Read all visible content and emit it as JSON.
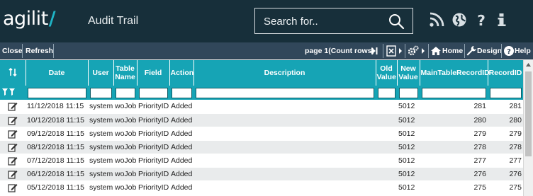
{
  "header": {
    "logo_text": "agilit",
    "title": "Audit Trail",
    "search_placeholder": "Search for..",
    "icons": [
      "rss-icon",
      "globe-icon",
      "help-icon",
      "info-icon"
    ]
  },
  "toolbar": {
    "close_label": "Close",
    "refresh_label": "Refresh",
    "page_text": "page 1(Count rows)",
    "home_label": "Home",
    "design_label": "Design",
    "help_label": "Help"
  },
  "grid": {
    "sort_icon": "sort-icon",
    "columns": [
      "Date",
      "User",
      "Table Name",
      "Field",
      "Action",
      "Description",
      "Old Value",
      "New Value",
      "MainTableRecordID",
      "RecordID"
    ],
    "rows": [
      {
        "date": "11/12/2018 11:15",
        "user": "system",
        "table": "woJob",
        "field": "PriorityID",
        "action": "Added",
        "description": "",
        "old": "",
        "new": "5012",
        "main_id": "281",
        "record_id": "281"
      },
      {
        "date": "10/12/2018 11:15",
        "user": "system",
        "table": "woJob",
        "field": "PriorityID",
        "action": "Added",
        "description": "",
        "old": "",
        "new": "5012",
        "main_id": "280",
        "record_id": "280"
      },
      {
        "date": "09/12/2018 11:15",
        "user": "system",
        "table": "woJob",
        "field": "PriorityID",
        "action": "Added",
        "description": "",
        "old": "",
        "new": "5012",
        "main_id": "279",
        "record_id": "279"
      },
      {
        "date": "08/12/2018 11:15",
        "user": "system",
        "table": "woJob",
        "field": "PriorityID",
        "action": "Added",
        "description": "",
        "old": "",
        "new": "5012",
        "main_id": "278",
        "record_id": "278"
      },
      {
        "date": "07/12/2018 11:15",
        "user": "system",
        "table": "woJob",
        "field": "PriorityID",
        "action": "Added",
        "description": "",
        "old": "",
        "new": "5012",
        "main_id": "277",
        "record_id": "277"
      },
      {
        "date": "06/12/2018 11:15",
        "user": "system",
        "table": "woJob",
        "field": "PriorityID",
        "action": "Added",
        "description": "",
        "old": "",
        "new": "5012",
        "main_id": "276",
        "record_id": "276"
      },
      {
        "date": "05/12/2018 11:15",
        "user": "system",
        "table": "woJob",
        "field": "PriorityID",
        "action": "Added",
        "description": "",
        "old": "",
        "new": "5012",
        "main_id": "275",
        "record_id": "275"
      }
    ]
  },
  "colors": {
    "header_bg": "#172f3a",
    "toolbar_bg": "#31475a",
    "accent_teal": "#16a4b5",
    "row_alt": "#e9ebec"
  }
}
